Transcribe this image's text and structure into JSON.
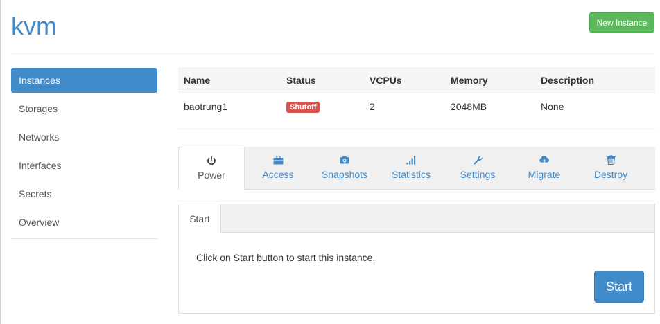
{
  "header": {
    "title": "kvm",
    "new_instance_label": "New Instance"
  },
  "sidebar": {
    "items": [
      {
        "label": "Instances",
        "active": true
      },
      {
        "label": "Storages"
      },
      {
        "label": "Networks"
      },
      {
        "label": "Interfaces"
      },
      {
        "label": "Secrets"
      },
      {
        "label": "Overview"
      }
    ]
  },
  "table": {
    "columns": [
      "Name",
      "Status",
      "VCPUs",
      "Memory",
      "Description"
    ],
    "rows": [
      {
        "name": "baotrung1",
        "status": "Shutoff",
        "vcpus": "2",
        "memory": "2048MB",
        "description": "None"
      }
    ]
  },
  "colors": {
    "accent": "#428bca",
    "success": "#5cb85c",
    "danger": "#d9534f"
  },
  "action_tabs": [
    {
      "label": "Power",
      "icon": "power-icon",
      "active": true
    },
    {
      "label": "Access",
      "icon": "briefcase-icon"
    },
    {
      "label": "Snapshots",
      "icon": "camera-icon"
    },
    {
      "label": "Statistics",
      "icon": "signal-icon"
    },
    {
      "label": "Settings",
      "icon": "wrench-icon"
    },
    {
      "label": "Migrate",
      "icon": "cloud-upload-icon"
    },
    {
      "label": "Destroy",
      "icon": "trash-icon"
    }
  ],
  "power_panel": {
    "tab_label": "Start",
    "message": "Click on Start button to start this instance.",
    "start_button_label": "Start"
  }
}
